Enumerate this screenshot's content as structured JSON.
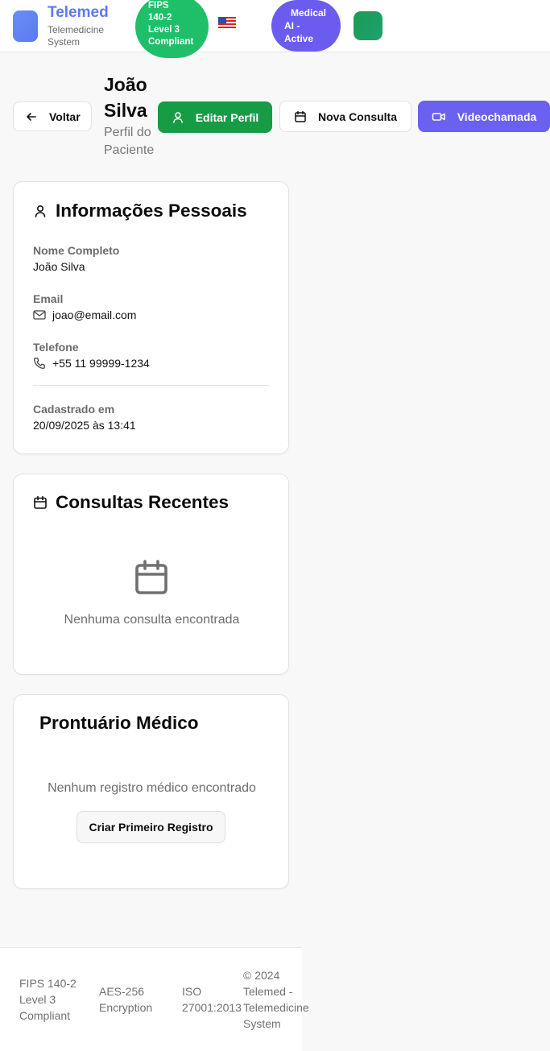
{
  "header": {
    "brand_title": "Telemed",
    "brand_subtitle": "Telemedicine System",
    "fips_badge": [
      "FIPS",
      "140-2",
      "Level 3",
      "Compliant"
    ],
    "ai_badge": [
      "Medical",
      "AI -",
      "Active"
    ],
    "colors": {
      "brand": "#5b7bf0",
      "fips": "#1fbf6a",
      "ai": "#6b5cf0",
      "avatar": "#1a9c53"
    },
    "flag_icon": "us-flag-icon"
  },
  "page_header": {
    "back_label": "Voltar",
    "patient_name": "João Silva",
    "patient_subtitle": "Perfil do Paciente",
    "edit_label": "Editar Perfil",
    "new_consult_label": "Nova Consulta",
    "video_label": "Videochamada"
  },
  "personal_info": {
    "title": "Informações Pessoais",
    "name_label": "Nome Completo",
    "name_value": "João Silva",
    "email_label": "Email",
    "email_value": "joao@email.com",
    "phone_label": "Telefone",
    "phone_value": "+55 11 99999-1234",
    "registered_label": "Cadastrado em",
    "registered_value": "20/09/2025 às 13:41"
  },
  "consultations": {
    "title": "Consultas Recentes",
    "empty_text": "Nenhuma consulta encontrada"
  },
  "medical_record": {
    "title": "Prontuário Médico",
    "empty_text": "Nenhum registro médico encontrado",
    "create_label": "Criar Primeiro Registro"
  },
  "footer": {
    "items": [
      "FIPS 140-2 Level 3 Compliant",
      "AES-256 Encryption",
      "ISO 27001:2013",
      "© 2024 Telemed - Telemedicine System"
    ]
  }
}
